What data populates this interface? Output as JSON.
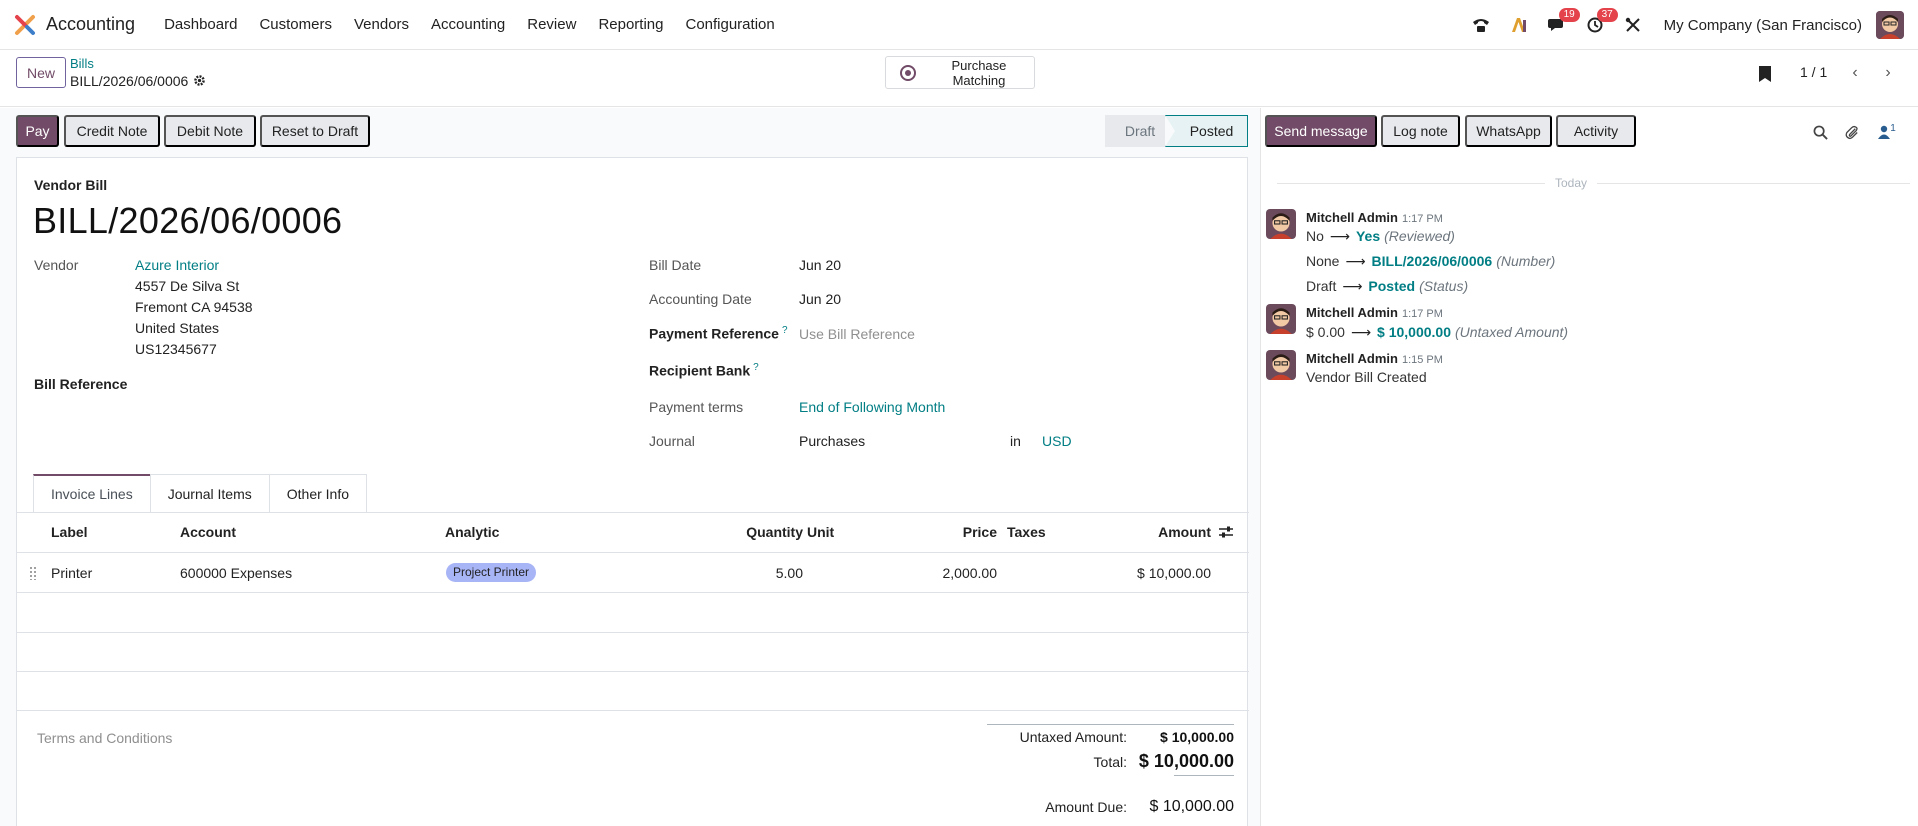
{
  "navbar": {
    "app_name": "Accounting",
    "menu": [
      "Dashboard",
      "Customers",
      "Vendors",
      "Accounting",
      "Review",
      "Reporting",
      "Configuration"
    ],
    "messages_badge": "19",
    "activities_badge": "37",
    "company": "My Company (San Francisco)"
  },
  "control_panel": {
    "new_label": "New",
    "breadcrumb_parent": "Bills",
    "breadcrumb_current": "BILL/2026/06/0006",
    "purchase_matching_label": "Purchase Matching",
    "pager": "1 / 1"
  },
  "actions": {
    "pay": "Pay",
    "credit_note": "Credit Note",
    "debit_note": "Debit Note",
    "reset_to_draft": "Reset to Draft",
    "status_draft": "Draft",
    "status_posted": "Posted"
  },
  "form": {
    "type_label": "Vendor Bill",
    "title": "BILL/2026/06/0006",
    "vendor_label": "Vendor",
    "vendor_name": "Azure Interior",
    "vendor_address": [
      "4557 De Silva St",
      "Fremont CA 94538",
      "United States",
      "US12345677"
    ],
    "bill_reference_label": "Bill Reference",
    "bill_date_label": "Bill Date",
    "bill_date": "Jun 20",
    "accounting_date_label": "Accounting Date",
    "accounting_date": "Jun 20",
    "payment_reference_label": "Payment Reference",
    "payment_reference_placeholder": "Use Bill Reference",
    "recipient_bank_label": "Recipient Bank",
    "payment_terms_label": "Payment terms",
    "payment_terms": "End of Following Month",
    "journal_label": "Journal",
    "journal": "Purchases",
    "in_label": "in",
    "currency": "USD",
    "help_mark": "?"
  },
  "tabs": [
    "Invoice Lines",
    "Journal Items",
    "Other Info"
  ],
  "table": {
    "headers": {
      "label": "Label",
      "account": "Account",
      "analytic": "Analytic",
      "quantity": "Quantity",
      "unit": "Unit",
      "price": "Price",
      "taxes": "Taxes",
      "amount": "Amount"
    },
    "rows": [
      {
        "label": "Printer",
        "account": "600000 Expenses",
        "analytic": "Project Printer",
        "quantity": "5.00",
        "unit": "",
        "price": "2,000.00",
        "taxes": "",
        "amount": "$ 10,000.00"
      }
    ]
  },
  "totals": {
    "terms_placeholder": "Terms and Conditions",
    "untaxed_label": "Untaxed Amount:",
    "untaxed_value": "$ 10,000.00",
    "total_label": "Total:",
    "total_value": "$ 10,000.00",
    "amount_due_label": "Amount Due:",
    "amount_due_value": "$ 10,000.00"
  },
  "chatter": {
    "send_message": "Send message",
    "log_note": "Log note",
    "whatsapp": "WhatsApp",
    "activity": "Activity",
    "followers_count": "1",
    "today": "Today",
    "messages": [
      {
        "author": "Mitchell Admin",
        "time": "1:17 PM",
        "changes": [
          {
            "old": "No",
            "new": "Yes",
            "field": "(Reviewed)"
          },
          {
            "old": "None",
            "new": "BILL/2026/06/0006",
            "field": "(Number)"
          },
          {
            "old": "Draft",
            "new": "Posted",
            "field": "(Status)"
          }
        ]
      },
      {
        "author": "Mitchell Admin",
        "time": "1:17 PM",
        "changes": [
          {
            "old": "$ 0.00",
            "new": "$ 10,000.00",
            "field": "(Untaxed Amount)"
          }
        ]
      },
      {
        "author": "Mitchell Admin",
        "time": "1:15 PM",
        "body": "Vendor Bill Created"
      }
    ]
  },
  "colors": {
    "primary": "#714b67",
    "link": "#017e84",
    "badge": "#e4434c",
    "analytic_tag": "#a7b4f5"
  }
}
